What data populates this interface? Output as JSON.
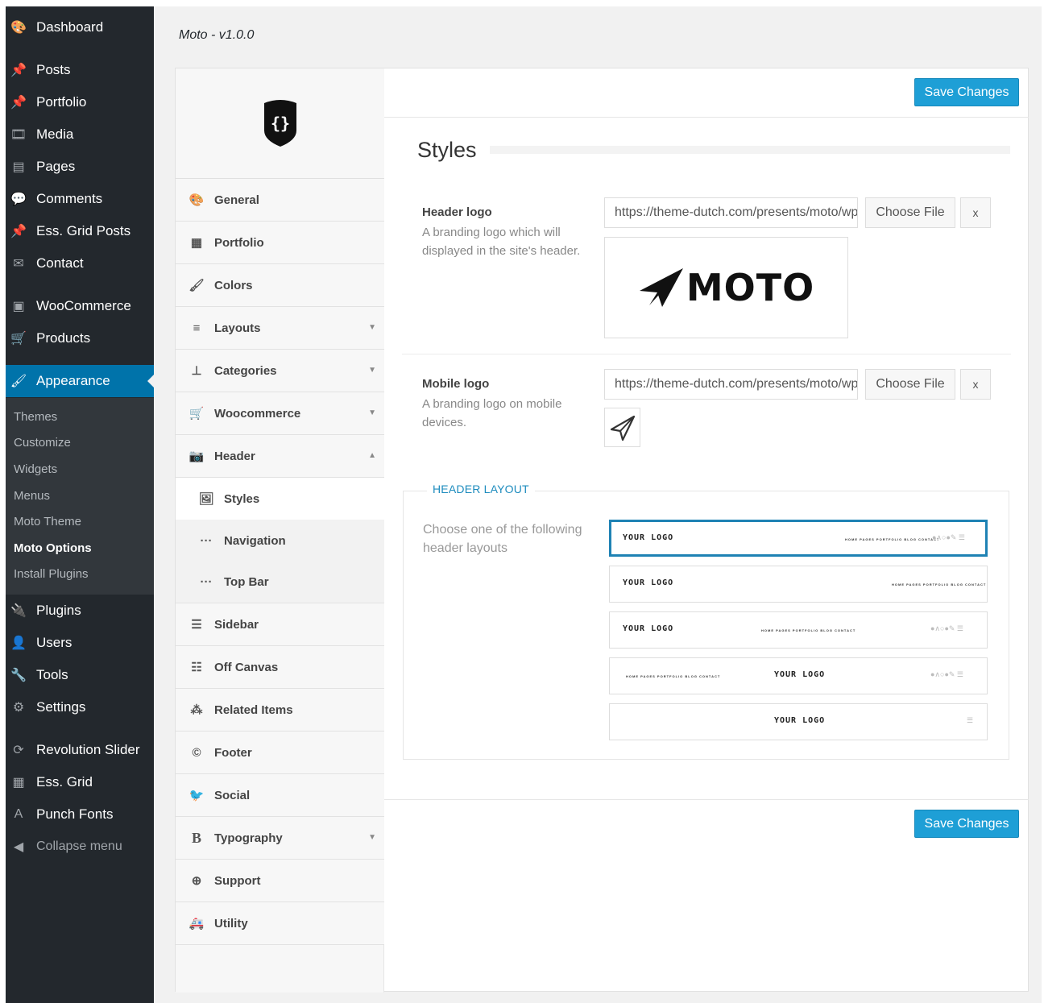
{
  "wp_menu": {
    "items": [
      {
        "label": "Dashboard",
        "icon": "dashboard-icon",
        "glyph": "🎨"
      },
      {
        "label": "Posts",
        "icon": "pin-icon",
        "glyph": "📌"
      },
      {
        "label": "Portfolio",
        "icon": "pin-icon",
        "glyph": "📌"
      },
      {
        "label": "Media",
        "icon": "media-icon",
        "glyph": "🎞"
      },
      {
        "label": "Pages",
        "icon": "pages-icon",
        "glyph": "▤"
      },
      {
        "label": "Comments",
        "icon": "comment-icon",
        "glyph": "💬"
      },
      {
        "label": "Ess. Grid Posts",
        "icon": "pin-icon",
        "glyph": "📌"
      },
      {
        "label": "Contact",
        "icon": "mail-icon",
        "glyph": "✉"
      },
      {
        "label": "WooCommerce",
        "icon": "woo-icon",
        "glyph": "▣"
      },
      {
        "label": "Products",
        "icon": "cart-icon",
        "glyph": "🛒"
      },
      {
        "label": "Appearance",
        "icon": "brush-icon",
        "glyph": "🖌"
      },
      {
        "label": "Plugins",
        "icon": "plug-icon",
        "glyph": "🔌"
      },
      {
        "label": "Users",
        "icon": "user-icon",
        "glyph": "👤"
      },
      {
        "label": "Tools",
        "icon": "wrench-icon",
        "glyph": "🔧"
      },
      {
        "label": "Settings",
        "icon": "settings-icon",
        "glyph": "⚙"
      },
      {
        "label": "Revolution Slider",
        "icon": "refresh-icon",
        "glyph": "⟳"
      },
      {
        "label": "Ess. Grid",
        "icon": "grid-icon",
        "glyph": "▦"
      },
      {
        "label": "Punch Fonts",
        "icon": "font-icon",
        "glyph": "A"
      }
    ],
    "submenu": [
      "Themes",
      "Customize",
      "Widgets",
      "Menus",
      "Moto Theme",
      "Moto Options",
      "Install Plugins"
    ],
    "collapse": "Collapse menu"
  },
  "version_title": "Moto - v1.0.0",
  "options_nav": [
    {
      "label": "General",
      "icon": "dashboard-icon",
      "glyph": "🎨"
    },
    {
      "label": "Portfolio",
      "icon": "grid-icon",
      "glyph": "▦"
    },
    {
      "label": "Colors",
      "icon": "brush-icon",
      "glyph": "🖌"
    },
    {
      "label": "Layouts",
      "icon": "layouts-icon",
      "glyph": "≡"
    },
    {
      "label": "Categories",
      "icon": "sitemap-icon",
      "glyph": "⊥"
    },
    {
      "label": "Woocommerce",
      "icon": "cart-icon",
      "glyph": "🛒"
    },
    {
      "label": "Header",
      "icon": "camera-icon",
      "glyph": "📷"
    },
    {
      "label": "Styles",
      "icon": "image-icon",
      "glyph": "🖼"
    },
    {
      "label": "Navigation",
      "icon": "ellipsis-icon",
      "glyph": "···"
    },
    {
      "label": "Top Bar",
      "icon": "ellipsis-icon",
      "glyph": "···"
    },
    {
      "label": "Sidebar",
      "icon": "list-icon",
      "glyph": "☰"
    },
    {
      "label": "Off Canvas",
      "icon": "offcanvas-icon",
      "glyph": "☷"
    },
    {
      "label": "Related Items",
      "icon": "cubes-icon",
      "glyph": "⁂"
    },
    {
      "label": "Footer",
      "icon": "copyright-icon",
      "glyph": "©"
    },
    {
      "label": "Social",
      "icon": "twitter-icon",
      "glyph": "🐦"
    },
    {
      "label": "Typography",
      "icon": "bold-icon",
      "glyph": "B"
    },
    {
      "label": "Support",
      "icon": "lifebuoy-icon",
      "glyph": "⊕"
    },
    {
      "label": "Utility",
      "icon": "ambulance-icon",
      "glyph": "🚑"
    }
  ],
  "save_label": "Save Changes",
  "section_title": "Styles",
  "header_logo": {
    "label": "Header logo",
    "desc": "A branding logo which will displayed in the site's header.",
    "url": "https://theme-dutch.com/presents/moto/wp-content/uploads/logo.png",
    "choose": "Choose File",
    "clear": "x",
    "logo_text": "MOTO"
  },
  "mobile_logo": {
    "label": "Mobile logo",
    "desc": "A branding logo on mobile devices.",
    "url": "https://theme-dutch.com/presents/moto/wp-content/uploads/logo-mobile.png",
    "choose": "Choose File",
    "clear": "x"
  },
  "header_layout": {
    "title": "HEADER LAYOUT",
    "desc": "Choose one of the following header layouts",
    "logo_text": "YOUR LOGO",
    "menu_text": "HOME   PAGES   PORTFOLIO   BLOG   CONTACT",
    "icons_text": "●∧○●✎ ☰",
    "burger": "☰"
  },
  "colors": {
    "accent": "#1e9fd6",
    "menu_bg": "#23282d",
    "active": "#0073aa"
  }
}
